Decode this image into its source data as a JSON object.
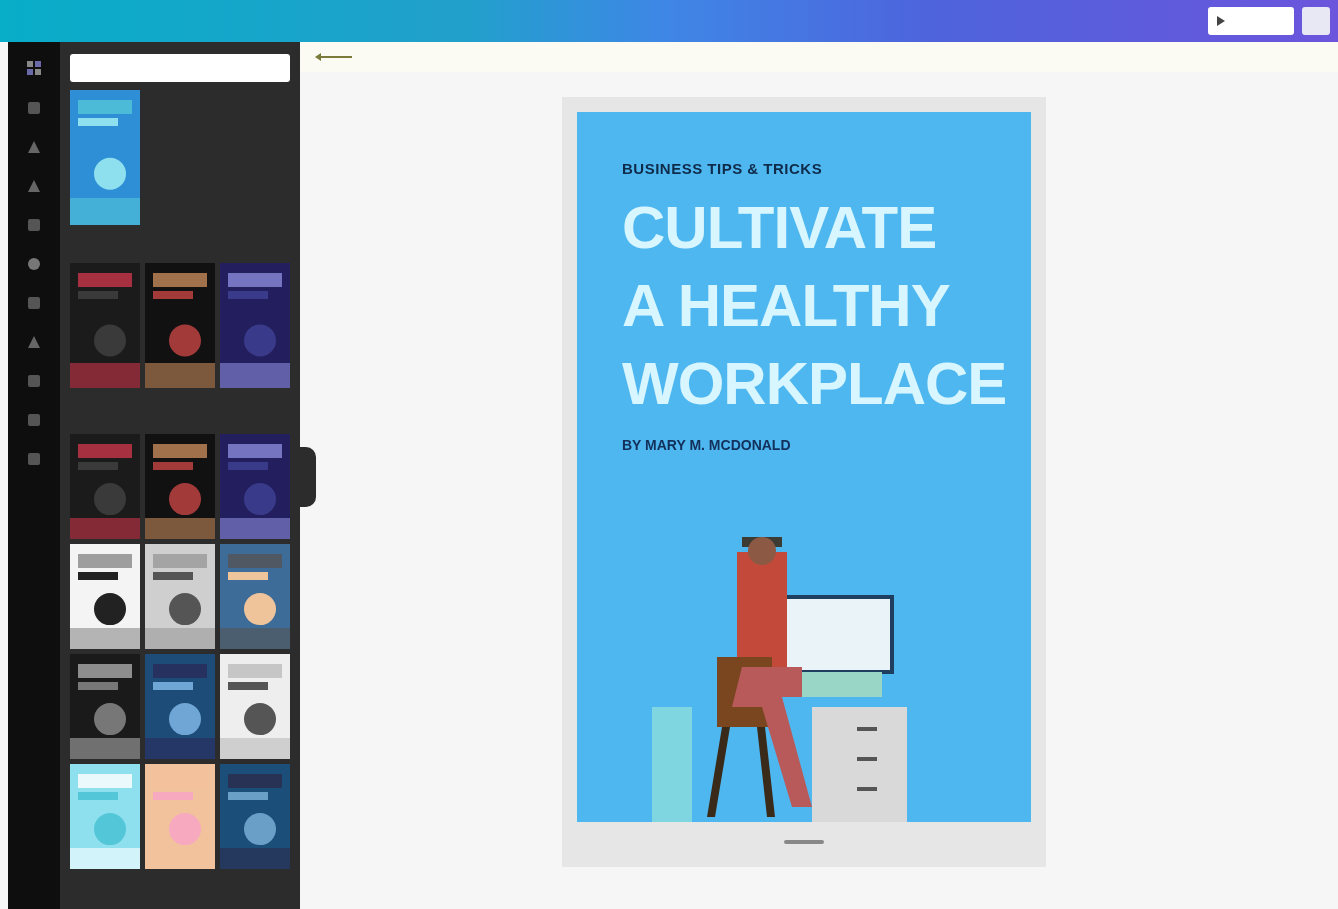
{
  "cover": {
    "kicker": "BUSINESS TIPS & TRICKS",
    "title_lines": [
      "CULTIVATE",
      "A HEALTHY",
      "WORKPLACE"
    ],
    "byline": "BY MARY M. MCDONALD"
  }
}
